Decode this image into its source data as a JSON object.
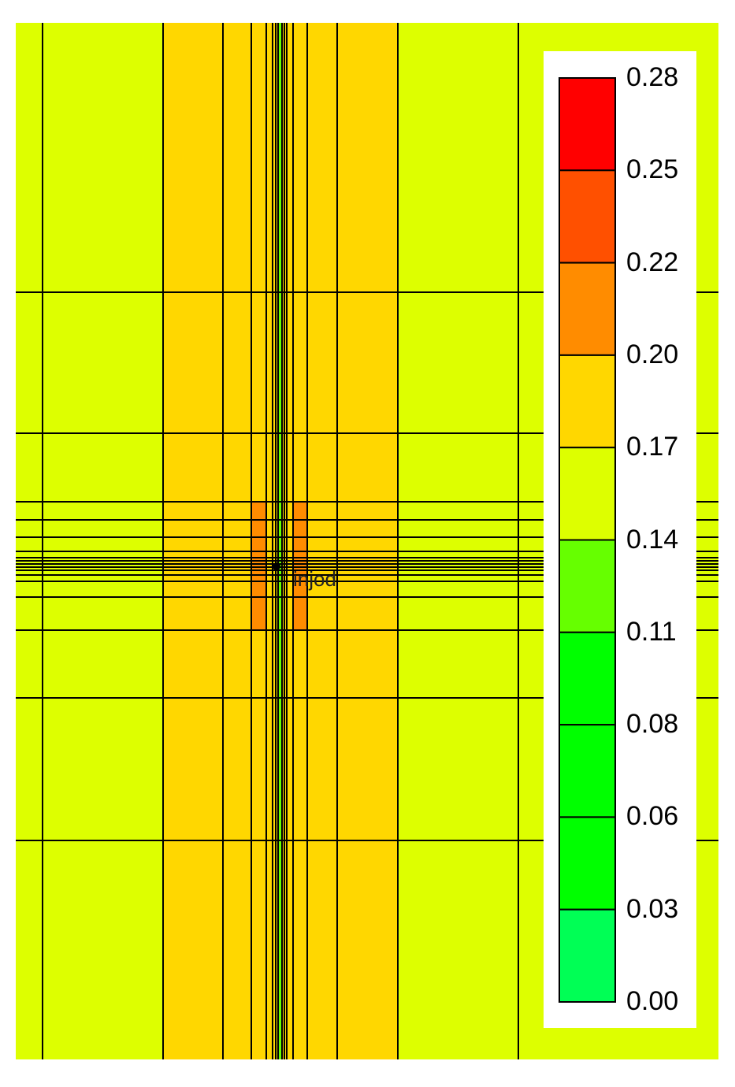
{
  "chart_data": {
    "type": "heatmap",
    "title": "",
    "well_label": "injod",
    "cell_values": {
      "background": 0.155,
      "central_band": 0.185,
      "near_well": 0.21,
      "well_column": 0.125
    },
    "colorbar": {
      "ticks": [
        "0.28",
        "0.25",
        "0.22",
        "0.20",
        "0.17",
        "0.14",
        "0.11",
        "0.08",
        "0.06",
        "0.03",
        "0.00"
      ],
      "range": [
        0.0,
        0.28
      ],
      "bins": [
        {
          "min": 0.25,
          "max": 0.28,
          "color": "#FF0000"
        },
        {
          "min": 0.22,
          "max": 0.25,
          "color": "#FF5000"
        },
        {
          "min": 0.2,
          "max": 0.22,
          "color": "#FF8C00"
        },
        {
          "min": 0.17,
          "max": 0.2,
          "color": "#FFD700"
        },
        {
          "min": 0.14,
          "max": 0.17,
          "color": "#DDFF00"
        },
        {
          "min": 0.11,
          "max": 0.14,
          "color": "#66FF00"
        },
        {
          "min": 0.08,
          "max": 0.11,
          "color": "#00FF00"
        },
        {
          "min": 0.06,
          "max": 0.08,
          "color": "#00FF00"
        },
        {
          "min": 0.03,
          "max": 0.06,
          "color": "#00FF00"
        },
        {
          "min": 0.0,
          "max": 0.03,
          "color": "#00FF55"
        }
      ]
    }
  }
}
